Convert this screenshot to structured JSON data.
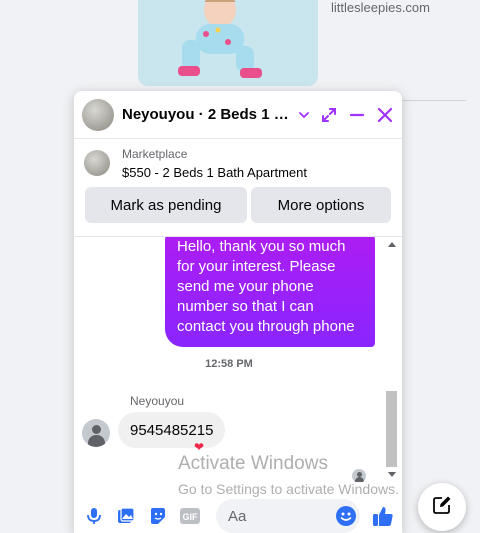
{
  "background": {
    "link_text": "littlesleepies.com"
  },
  "chat": {
    "title": "Neyouyou · 2 Beds 1 Bath Apartment",
    "listing": {
      "source": "Marketplace",
      "name": "$550 - 2 Beds 1 Bath Apartment"
    },
    "actions": {
      "mark_pending": "Mark as pending",
      "more_options": "More options"
    },
    "messages": {
      "outgoing": "Hello, thank you so much for your interest. Please send me your phone number so that I can contact you through phone",
      "timestamp": "12:58 PM",
      "sender": "Neyouyou",
      "incoming": "9545485215",
      "reaction": "❤"
    },
    "composer": {
      "placeholder": "Aa"
    }
  },
  "watermark": {
    "line1": "Activate Windows",
    "line2": "Go to Settings to activate Windows."
  },
  "icons": [
    "chevron-down-icon",
    "expand-icon",
    "minimize-icon",
    "close-icon",
    "microphone-icon",
    "photo-icon",
    "sticker-icon",
    "gif-icon",
    "emoji-icon",
    "like-icon",
    "compose-icon"
  ],
  "colors": {
    "accent": "#a033ff",
    "bubble_top": "#b01cf2",
    "bubble_bottom": "#8a25ff",
    "icon_blue": "#2f6ff5"
  }
}
